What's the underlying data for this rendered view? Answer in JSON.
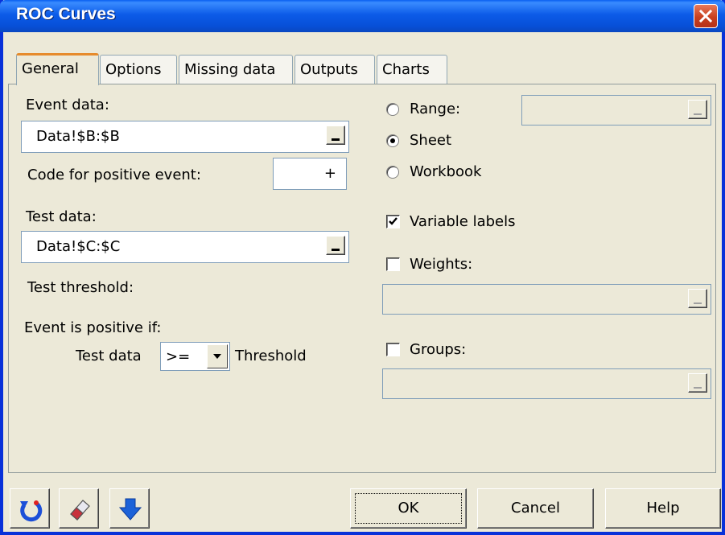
{
  "window": {
    "title": "ROC Curves",
    "close_icon": "close-x-icon"
  },
  "tabs": [
    {
      "label": "General",
      "selected": true
    },
    {
      "label": "Options",
      "selected": false
    },
    {
      "label": "Missing data",
      "selected": false
    },
    {
      "label": "Outputs",
      "selected": false
    },
    {
      "label": "Charts",
      "selected": false
    }
  ],
  "general": {
    "event_data_label": "Event data:",
    "event_data_value": "Data!$B:$B",
    "code_positive_label": "Code for positive event:",
    "code_positive_value": "+",
    "test_data_label": "Test data:",
    "test_data_value": "Data!$C:$C",
    "test_threshold_label": "Test threshold:",
    "event_positive_label": "Event is positive if:",
    "rule_prefix": "Test data",
    "operator_selected": ">=",
    "rule_suffix": "Threshold"
  },
  "output_location": {
    "range_label": "Range:",
    "sheet_label": "Sheet",
    "workbook_label": "Workbook",
    "selected": "Sheet"
  },
  "options": {
    "variable_labels_label": "Variable labels",
    "variable_labels_checked": true,
    "weights_label": "Weights:",
    "weights_checked": false,
    "groups_label": "Groups:",
    "groups_checked": false
  },
  "footer": {
    "icons": [
      "reset-icon",
      "eraser-icon",
      "down-arrow-icon"
    ],
    "ok_label": "OK",
    "cancel_label": "Cancel",
    "help_label": "Help"
  }
}
